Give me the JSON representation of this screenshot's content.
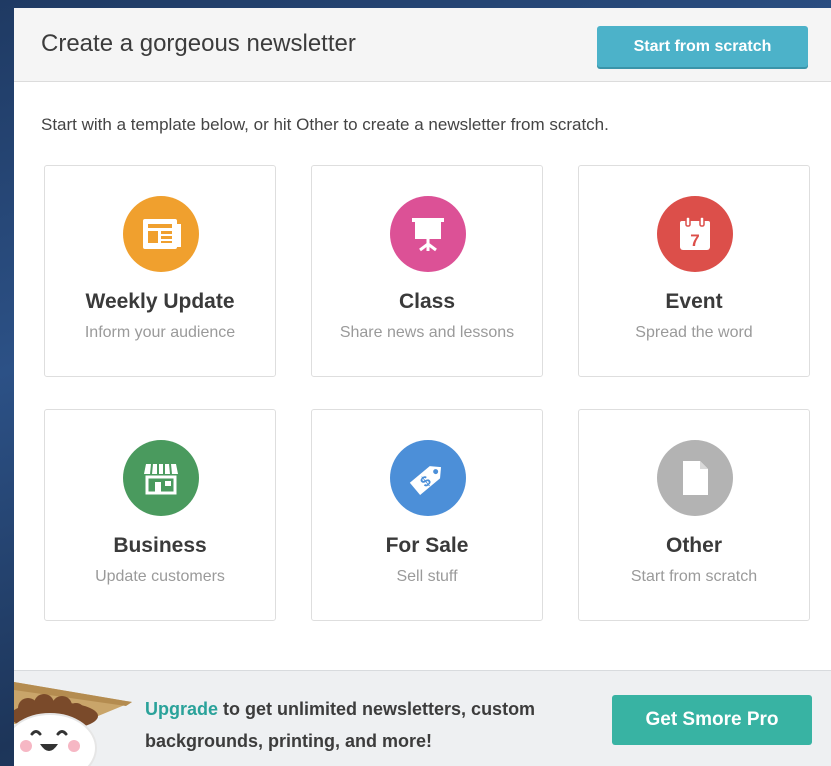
{
  "header": {
    "title": "Create a gorgeous newsletter",
    "scratch_button": "Start from scratch"
  },
  "intro": "Start with a template below, or hit Other to create a newsletter from scratch.",
  "templates": [
    {
      "name": "Weekly Update",
      "desc": "Inform your audience",
      "icon": "newspaper-icon",
      "color": "#f0a02e"
    },
    {
      "name": "Class",
      "desc": "Share news and lessons",
      "icon": "presentation-board-icon",
      "color": "#dc5196"
    },
    {
      "name": "Event",
      "desc": "Spread the word",
      "icon": "calendar-icon",
      "color": "#dc4f4a",
      "icon_text": "7"
    },
    {
      "name": "Business",
      "desc": "Update customers",
      "icon": "storefront-icon",
      "color": "#4a9a5e"
    },
    {
      "name": "For Sale",
      "desc": "Sell stuff",
      "icon": "price-tag-icon",
      "color": "#4c8fd8",
      "icon_text": "$"
    },
    {
      "name": "Other",
      "desc": "Start from scratch",
      "icon": "document-icon",
      "color": "#b3b3b3"
    }
  ],
  "footer": {
    "upgrade_link": "Upgrade",
    "message": " to get unlimited newsletters, custom backgrounds, printing, and more!",
    "pro_button": "Get Smore Pro"
  }
}
